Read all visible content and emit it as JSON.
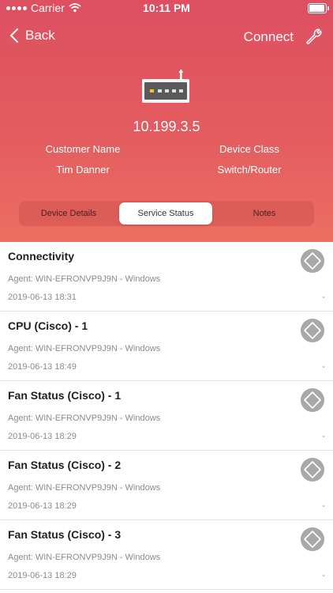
{
  "status_bar": {
    "carrier": "Carrier",
    "time": "10:11 PM"
  },
  "nav": {
    "back_label": "Back",
    "connect_label": "Connect"
  },
  "device": {
    "ip": "10.199.3.5",
    "customer_name_label": "Customer Name",
    "customer_name": "Tim Danner",
    "device_class_label": "Device Class",
    "device_class": "Switch/Router"
  },
  "tabs": [
    "Device Details",
    "Service Status",
    "Notes"
  ],
  "services": [
    {
      "name": "Connectivity",
      "agent": "Agent: WIN-EFRONVP9J9N - Windows",
      "time": "2019-06-13 18:31",
      "value": "-"
    },
    {
      "name": "CPU (Cisco) - 1",
      "agent": "Agent: WIN-EFRONVP9J9N - Windows",
      "time": "2019-06-13 18:49",
      "value": "-"
    },
    {
      "name": "Fan Status (Cisco) - 1",
      "agent": "Agent: WIN-EFRONVP9J9N - Windows",
      "time": "2019-06-13 18:29",
      "value": "-"
    },
    {
      "name": "Fan Status (Cisco) - 2",
      "agent": "Agent: WIN-EFRONVP9J9N - Windows",
      "time": "2019-06-13 18:29",
      "value": "-"
    },
    {
      "name": "Fan Status (Cisco) - 3",
      "agent": "Agent: WIN-EFRONVP9J9N - Windows",
      "time": "2019-06-13 18:29",
      "value": "-"
    }
  ],
  "colors": {
    "header_top": "#de4f61",
    "header_bottom": "#ec6e60",
    "status_icon": "#a8a8a8"
  }
}
